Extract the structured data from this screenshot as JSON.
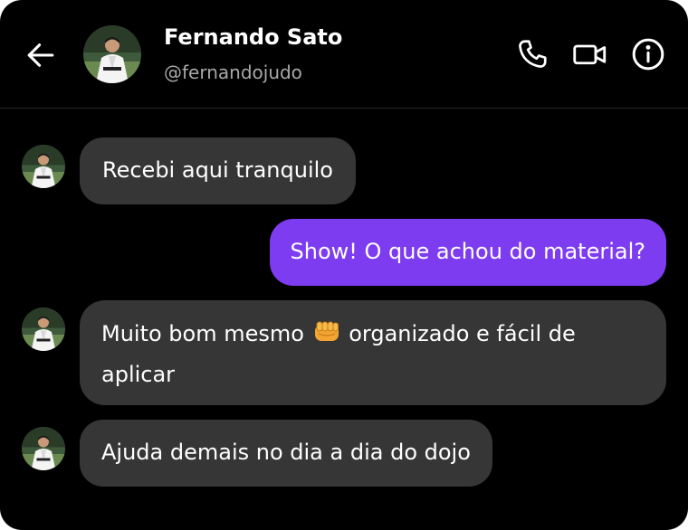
{
  "header": {
    "name": "Fernando Sato",
    "handle": "@fernandojudo"
  },
  "icons": {
    "back": "arrow-left-icon",
    "call": "phone-icon",
    "video": "video-camera-icon",
    "info": "info-icon"
  },
  "messages": [
    {
      "direction": "incoming",
      "text": "Recebi aqui tranquilo"
    },
    {
      "direction": "outgoing",
      "text": "Show! O que achou do material?"
    },
    {
      "direction": "incoming",
      "text_before": "Muito bom mesmo",
      "emoji": "oncoming-fist-emoji",
      "text_after": "organizado e fácil de aplicar"
    },
    {
      "direction": "incoming",
      "text": "Ajuda demais no dia a dia do dojo"
    }
  ],
  "colors": {
    "background": "#000000",
    "incoming_bubble": "#363636",
    "outgoing_bubble": "#7d3cf0",
    "secondary_text": "#a8a8a8"
  }
}
